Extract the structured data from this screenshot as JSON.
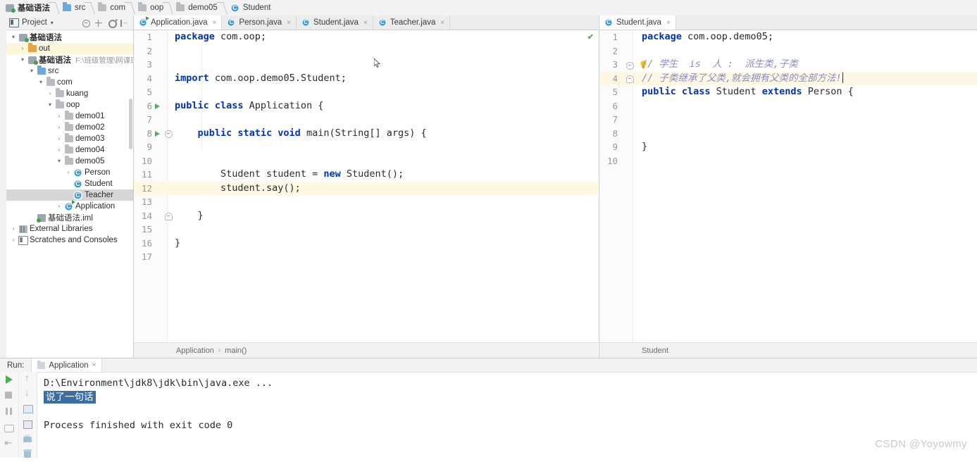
{
  "breadcrumbs": [
    {
      "label": "基础语法",
      "icon": "module-icon",
      "bold": true
    },
    {
      "label": "src",
      "icon": "source-folder-icon",
      "bold": false
    },
    {
      "label": "com",
      "icon": "folder-icon",
      "bold": false
    },
    {
      "label": "oop",
      "icon": "folder-icon",
      "bold": false
    },
    {
      "label": "demo05",
      "icon": "folder-icon",
      "bold": false
    },
    {
      "label": "Student",
      "icon": "class-icon",
      "bold": false
    }
  ],
  "project_panel": {
    "title": "Project",
    "caret": "▾",
    "icons": [
      "project-view-icon",
      "collapse-all-icon",
      "expand-all-icon",
      "settings-gear-icon",
      "hide-panel-icon"
    ],
    "tree": [
      {
        "label": "基础语法",
        "depth": 0,
        "arrow": "▾",
        "icon": "module-icon",
        "bold": true,
        "state": "normal",
        "path": ""
      },
      {
        "label": "out",
        "depth": 1,
        "arrow": "›",
        "icon": "out-folder-icon",
        "bold": false,
        "state": "highlight",
        "path": ""
      },
      {
        "label": "基础语法",
        "depth": 1,
        "arrow": "▾",
        "icon": "module-icon",
        "bold": true,
        "state": "normal",
        "path": "F:\\班级管理\\网课班\\"
      },
      {
        "label": "src",
        "depth": 2,
        "arrow": "▾",
        "icon": "source-folder-icon",
        "bold": false,
        "state": "normal",
        "path": ""
      },
      {
        "label": "com",
        "depth": 3,
        "arrow": "▾",
        "icon": "package-icon",
        "bold": false,
        "state": "normal",
        "path": ""
      },
      {
        "label": "kuang",
        "depth": 4,
        "arrow": "›",
        "icon": "package-icon",
        "bold": false,
        "state": "normal",
        "path": ""
      },
      {
        "label": "oop",
        "depth": 4,
        "arrow": "▾",
        "icon": "package-icon",
        "bold": false,
        "state": "normal",
        "path": ""
      },
      {
        "label": "demo01",
        "depth": 5,
        "arrow": "›",
        "icon": "package-icon",
        "bold": false,
        "state": "normal",
        "path": ""
      },
      {
        "label": "demo02",
        "depth": 5,
        "arrow": "›",
        "icon": "package-icon",
        "bold": false,
        "state": "normal",
        "path": ""
      },
      {
        "label": "demo03",
        "depth": 5,
        "arrow": "›",
        "icon": "package-icon",
        "bold": false,
        "state": "normal",
        "path": ""
      },
      {
        "label": "demo04",
        "depth": 5,
        "arrow": "›",
        "icon": "package-icon",
        "bold": false,
        "state": "normal",
        "path": ""
      },
      {
        "label": "demo05",
        "depth": 5,
        "arrow": "▾",
        "icon": "package-icon",
        "bold": false,
        "state": "normal",
        "path": ""
      },
      {
        "label": "Person",
        "depth": 6,
        "arrow": "›",
        "icon": "class-icon",
        "bold": false,
        "state": "normal",
        "path": ""
      },
      {
        "label": "Student",
        "depth": 6,
        "arrow": "",
        "icon": "class-icon",
        "bold": false,
        "state": "normal",
        "path": ""
      },
      {
        "label": "Teacher",
        "depth": 6,
        "arrow": "",
        "icon": "class-icon",
        "bold": false,
        "state": "selected",
        "path": ""
      },
      {
        "label": "Application",
        "depth": 5,
        "arrow": "›",
        "icon": "runnable-class-icon",
        "bold": false,
        "state": "normal",
        "path": ""
      },
      {
        "label": "基础语法.iml",
        "depth": 2,
        "arrow": "",
        "icon": "iml-file-icon",
        "bold": false,
        "state": "normal",
        "path": ""
      },
      {
        "label": "External Libraries",
        "depth": 0,
        "arrow": "›",
        "icon": "library-icon",
        "bold": false,
        "state": "normal",
        "path": ""
      },
      {
        "label": "Scratches and Consoles",
        "depth": 0,
        "arrow": "›",
        "icon": "scratches-icon",
        "bold": false,
        "state": "normal",
        "path": ""
      }
    ]
  },
  "editor_left": {
    "tabs": [
      {
        "label": "Application.java",
        "icon": "runnable-class-icon",
        "active": true
      },
      {
        "label": "Person.java",
        "icon": "class-icon",
        "active": false
      },
      {
        "label": "Student.java",
        "icon": "class-icon",
        "active": false
      },
      {
        "label": "Teacher.java",
        "icon": "class-icon",
        "active": false
      }
    ],
    "inspection_status": "✔",
    "lines": [
      {
        "n": "1",
        "tokens": [
          {
            "t": "package ",
            "c": "kw"
          },
          {
            "t": "com.oop;",
            "c": "pl"
          }
        ],
        "gutter": "",
        "hl": false
      },
      {
        "n": "2",
        "tokens": [],
        "gutter": "",
        "hl": false
      },
      {
        "n": "3",
        "tokens": [],
        "gutter": "",
        "hl": false
      },
      {
        "n": "4",
        "tokens": [
          {
            "t": "import ",
            "c": "kw"
          },
          {
            "t": "com.oop.demo05.Student;",
            "c": "pl"
          }
        ],
        "gutter": "",
        "hl": false
      },
      {
        "n": "5",
        "tokens": [],
        "gutter": "",
        "hl": false
      },
      {
        "n": "6",
        "tokens": [
          {
            "t": "public class ",
            "c": "kw"
          },
          {
            "t": "Application {",
            "c": "pl"
          }
        ],
        "gutter": "run",
        "hl": false
      },
      {
        "n": "7",
        "tokens": [],
        "gutter": "",
        "hl": false
      },
      {
        "n": "8",
        "tokens": [
          {
            "t": "    public static void ",
            "c": "kw"
          },
          {
            "t": "main(String[] args) {",
            "c": "pl"
          }
        ],
        "gutter": "run-fold",
        "hl": false
      },
      {
        "n": "9",
        "tokens": [],
        "gutter": "",
        "hl": false
      },
      {
        "n": "10",
        "tokens": [],
        "gutter": "",
        "hl": false
      },
      {
        "n": "11",
        "tokens": [
          {
            "t": "        Student student = ",
            "c": "pl"
          },
          {
            "t": "new ",
            "c": "kw"
          },
          {
            "t": "Student();",
            "c": "pl"
          }
        ],
        "gutter": "",
        "hl": false
      },
      {
        "n": "12",
        "tokens": [
          {
            "t": "        student.say();",
            "c": "pl"
          }
        ],
        "gutter": "",
        "hl": true
      },
      {
        "n": "13",
        "tokens": [],
        "gutter": "",
        "hl": false
      },
      {
        "n": "14",
        "tokens": [
          {
            "t": "    }",
            "c": "pl"
          }
        ],
        "gutter": "fold-tail",
        "hl": false
      },
      {
        "n": "15",
        "tokens": [],
        "gutter": "",
        "hl": false
      },
      {
        "n": "16",
        "tokens": [
          {
            "t": "}",
            "c": "pl"
          }
        ],
        "gutter": "",
        "hl": false
      },
      {
        "n": "17",
        "tokens": [],
        "gutter": "",
        "hl": false
      }
    ],
    "breadcrumb": {
      "class": "Application",
      "sep": "›",
      "method": "main()"
    }
  },
  "editor_right": {
    "tabs": [
      {
        "label": "Student.java",
        "icon": "class-icon",
        "active": true
      }
    ],
    "lines": [
      {
        "n": "1",
        "tokens": [
          {
            "t": "package ",
            "c": "kw"
          },
          {
            "t": "com.oop.demo05;",
            "c": "pl"
          }
        ],
        "gutter": "",
        "hl": false
      },
      {
        "n": "2",
        "tokens": [],
        "gutter": "",
        "hl": false
      },
      {
        "n": "3",
        "tokens": [
          {
            "t": "// 学生  is  人 :  派生类,子类",
            "c": "cmt"
          }
        ],
        "gutter": "fold-bulb",
        "hl": false
      },
      {
        "n": "4",
        "tokens": [
          {
            "t": "// 子类继承了父类,就会拥有父类的全部方法!",
            "c": "cmt"
          }
        ],
        "gutter": "fold-tail",
        "hl": true,
        "caret": true
      },
      {
        "n": "5",
        "tokens": [
          {
            "t": "public class ",
            "c": "kw"
          },
          {
            "t": "Student ",
            "c": "pl"
          },
          {
            "t": "extends ",
            "c": "kw"
          },
          {
            "t": "Person {",
            "c": "pl"
          }
        ],
        "gutter": "",
        "hl": false
      },
      {
        "n": "6",
        "tokens": [],
        "gutter": "",
        "hl": false
      },
      {
        "n": "7",
        "tokens": [],
        "gutter": "",
        "hl": false
      },
      {
        "n": "8",
        "tokens": [],
        "gutter": "",
        "hl": false
      },
      {
        "n": "9",
        "tokens": [
          {
            "t": "}",
            "c": "pl"
          }
        ],
        "gutter": "",
        "hl": false
      },
      {
        "n": "10",
        "tokens": [],
        "gutter": "",
        "hl": false
      }
    ],
    "breadcrumb": {
      "class": "Student",
      "sep": "",
      "method": ""
    }
  },
  "run_panel": {
    "label": "Run:",
    "tab": {
      "label": "Application",
      "icon": "run-config-icon",
      "close": "×"
    },
    "tool_icons_left": [
      "rerun-play-icon",
      "stop-icon",
      "pause-icon",
      "screenshot-icon",
      "exit-icon"
    ],
    "tool_icons_right": [
      "scroll-up-icon",
      "scroll-down-icon",
      "soft-wrap-icon",
      "open-in-window-icon",
      "print-icon",
      "clear-all-icon"
    ],
    "console": {
      "command": "D:\\Environment\\jdk8\\jdk\\bin\\java.exe ...",
      "output": "说了一句话",
      "finish": "Process finished with exit code 0"
    }
  },
  "watermark": "CSDN @Yoyowmy",
  "colors": {
    "keyword": "#0033b3",
    "comment": "#8c8cc0",
    "selection": "#3a6ea5",
    "run_green": "#59a869",
    "line_highlight": "#fdf8e3",
    "tree_selected": "#d6d6d6"
  }
}
